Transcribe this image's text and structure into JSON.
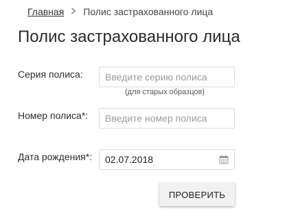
{
  "breadcrumb": {
    "home_label": "Главная",
    "separator_icon": "chevron-right-icon",
    "current_label": "Полис застрахованного лица"
  },
  "page": {
    "title": "Полис застрахованного лица"
  },
  "form": {
    "policy_series": {
      "label": "Серия полиса:",
      "placeholder": "Введите серию полиса",
      "value": "",
      "hint": "(для старых образцов)"
    },
    "policy_number": {
      "label": "Номер полиса*:",
      "placeholder": "Введите номер полиса",
      "value": ""
    },
    "birth_date": {
      "label": "Дата рождения*:",
      "value": "02.07.2018",
      "icon": "calendar-icon"
    },
    "submit_label": "ПРОВЕРИТЬ"
  },
  "colors": {
    "text": "#2b2b2b",
    "placeholder": "#9b9b9b",
    "border": "#dcdcdc",
    "button_bg": "#f1f1f1"
  }
}
